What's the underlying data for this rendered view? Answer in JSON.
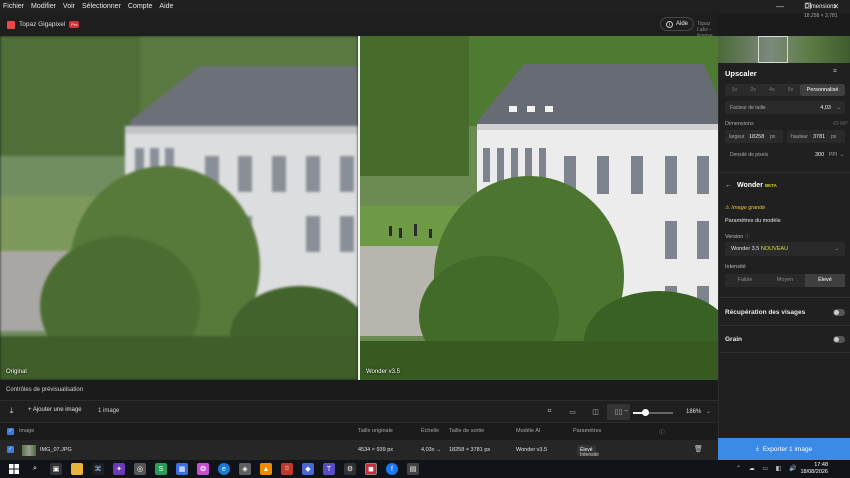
{
  "menubar": {
    "items": [
      "Fichier",
      "Modifier",
      "Voir",
      "Sélectionner",
      "Compte",
      "Aide"
    ]
  },
  "window_controls": [
    "—",
    "❐",
    "✕"
  ],
  "header": {
    "app_name": "Topaz Gigapixel",
    "app_badge": "Pro",
    "help_label": "Aide",
    "license_text": "Topaz Labs - license Rotterer   v1.0.4",
    "dimensions_label": "Dimensions",
    "dimensions_value": "18,258 × 3,781"
  },
  "preview": {
    "left_label": "Original",
    "right_label": "Wonder v3.5"
  },
  "controls_bar": {
    "label": "Contrôles de prévisualisation"
  },
  "toolbar": {
    "add_image_label": "Ajouter une image",
    "image_count": "1 image",
    "zoom_value": "186%"
  },
  "table": {
    "headers": [
      "Image",
      "Taille originale",
      "Échelle",
      "Taille de sortie",
      "Modèle AI",
      "Paramètres"
    ],
    "rows": [
      {
        "name": "IMG_07.JPG",
        "original_size": "4534 × 939 px",
        "scale": "4,03x →",
        "output_size": "18258 × 3781 px",
        "model": "Wonder v3.5",
        "params_label": "Intensité",
        "params_value": "Élevé"
      }
    ]
  },
  "sidebar": {
    "title": "Upscaler",
    "scale_options": [
      "1x",
      "2x",
      "4x",
      "6x",
      "Personnalisé"
    ],
    "scale_factor_label": "Facteur de taille",
    "scale_factor_value": "4,03",
    "dimensions_label": "Dimensions",
    "megapixels": "69 MP",
    "width_label": "largeur",
    "width_value": "18258",
    "height_label": "hauteur",
    "height_value": "3781",
    "unit": "px",
    "density_label": "Densité de pixels",
    "density_value": "300",
    "density_unit": "PPI",
    "model_name": "Wonder",
    "model_badge": "BETA",
    "warning": "Image grande",
    "model_params_title": "Paramètres du modèle",
    "version_label": "Version",
    "version_value": "Wonder 3.5",
    "version_new": "NOUVEAU",
    "intensity_label": "Intensité",
    "intensity_options": [
      "Faible",
      "Moyen",
      "Élevé"
    ],
    "face_recovery_label": "Récupération des visages",
    "grain_label": "Grain",
    "export_label": "Exporter 1 image"
  },
  "taskbar": {
    "time": "17:48",
    "date": "18/08/2026"
  },
  "colors": {
    "accent": "#3b8ae6",
    "new_badge": "#e2df32",
    "warning": "#e5c437"
  }
}
